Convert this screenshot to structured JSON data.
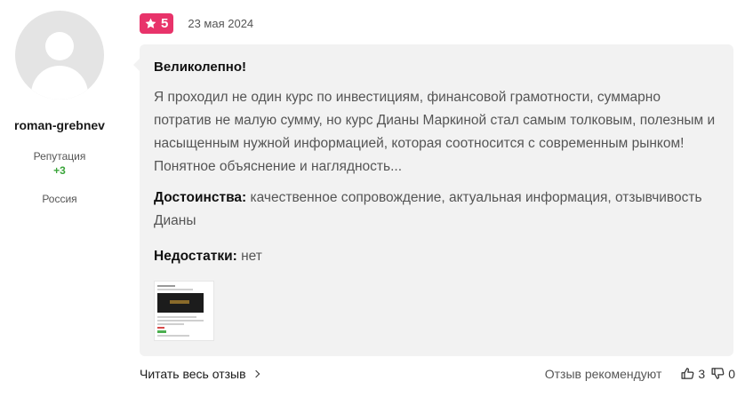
{
  "author": {
    "username": "roman-grebnev",
    "reputation_label": "Репутация",
    "reputation_value": "+3",
    "country": "Россия"
  },
  "review": {
    "rating": "5",
    "date": "23 мая 2024",
    "title": "Великолепно!",
    "text": "Я проходил не один курс по инвестициям, финансовой грамотности, суммарно потратив не малую сумму, но курс Дианы Маркиной стал самым толковым, полезным и насыщенным нужной информацией, которая соотносится с современным рынком! Понятное объяснение и наглядность...",
    "pros_label": "Достоинства:",
    "pros_text": " качественное сопровождение, актуальная информация, отзывчивость Дианы",
    "cons_label": "Недостатки:",
    "cons_text": " нет"
  },
  "footer": {
    "read_more": "Читать весь отзыв",
    "recommend_label": "Отзыв рекомендуют",
    "likes": "3",
    "dislikes": "0"
  },
  "colors": {
    "badge": "#e8336a",
    "reputation": "#3aa53a",
    "bubble": "#f2f2f2"
  }
}
